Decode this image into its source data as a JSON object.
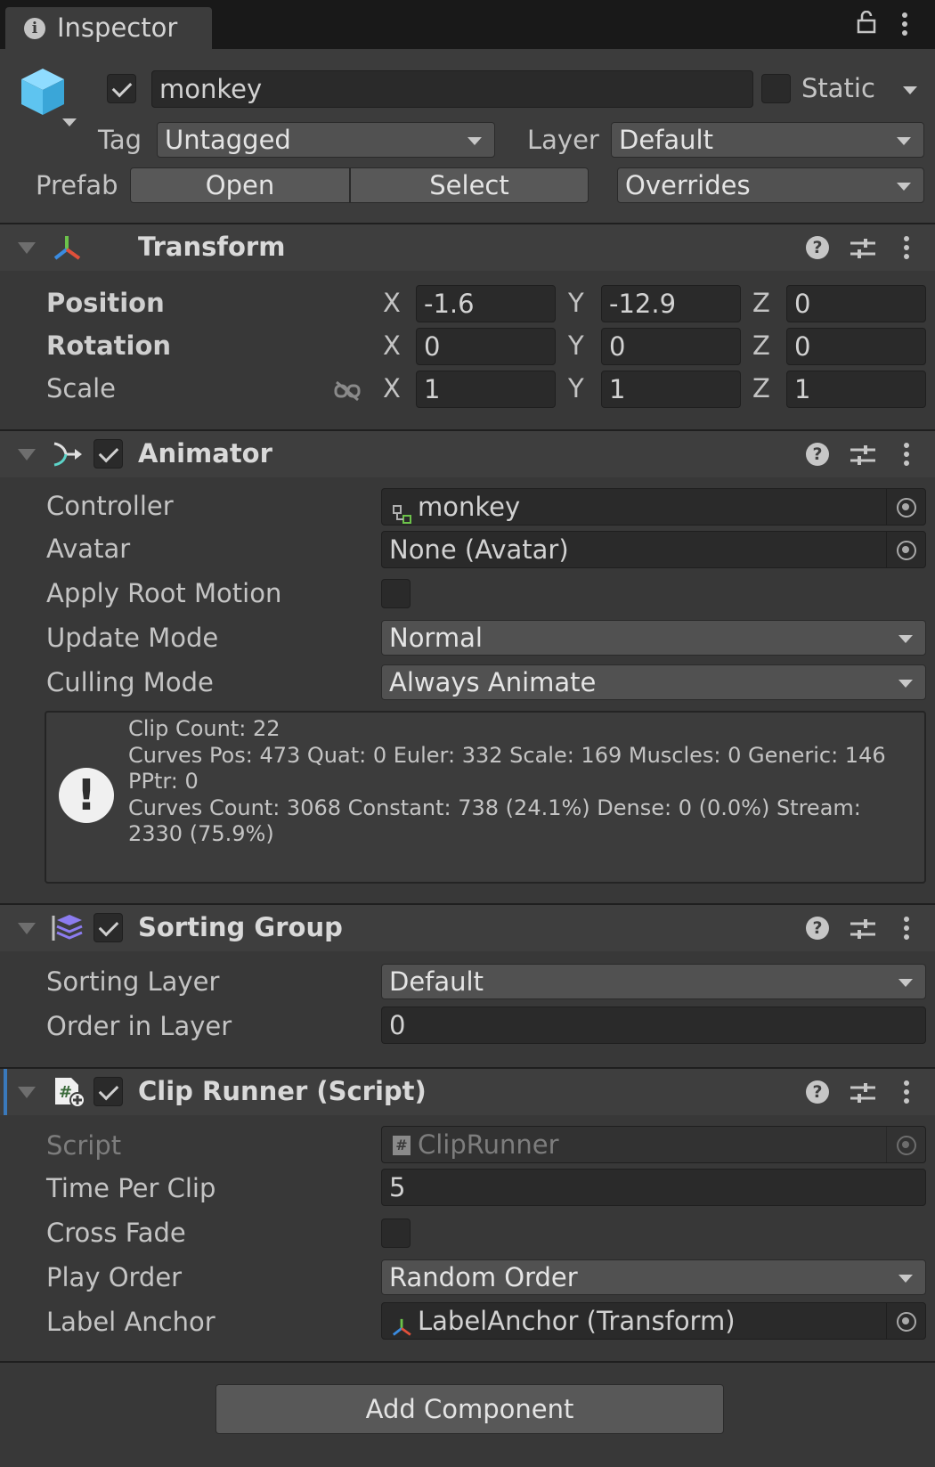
{
  "tab": {
    "title": "Inspector",
    "lock_icon": "lock-icon",
    "menu_icon": "kebab-menu-icon"
  },
  "header": {
    "active_checked": true,
    "name": "monkey",
    "static_label": "Static",
    "static_checked": false,
    "tag_label": "Tag",
    "tag_value": "Untagged",
    "layer_label": "Layer",
    "layer_value": "Default",
    "prefab_label": "Prefab",
    "open_label": "Open",
    "select_label": "Select",
    "overrides_label": "Overrides",
    "object_icon": "cube-icon"
  },
  "transform": {
    "title": "Transform",
    "icon": "transform-axes-icon",
    "position_label": "Position",
    "rotation_label": "Rotation",
    "scale_label": "Scale",
    "x": "X",
    "y": "Y",
    "z": "Z",
    "position": {
      "x": "-1.6",
      "y": "-12.9",
      "z": "0"
    },
    "rotation": {
      "x": "0",
      "y": "0",
      "z": "0"
    },
    "scale": {
      "x": "1",
      "y": "1",
      "z": "1"
    }
  },
  "animator": {
    "title": "Animator",
    "enabled": true,
    "icon": "animator-icon",
    "controller_label": "Controller",
    "controller_value": "monkey",
    "avatar_label": "Avatar",
    "avatar_value": "None (Avatar)",
    "apply_root_motion_label": "Apply Root Motion",
    "apply_root_motion": false,
    "update_mode_label": "Update Mode",
    "update_mode_value": "Normal",
    "culling_mode_label": "Culling Mode",
    "culling_mode_value": "Always Animate",
    "info_lines": [
      "Clip Count: 22",
      "Curves Pos: 473 Quat: 0 Euler: 332 Scale: 169 Muscles: 0 Generic: 146",
      "PPtr: 0",
      "Curves Count: 3068 Constant: 738 (24.1%) Dense: 0 (0.0%) Stream:",
      "2330 (75.9%)"
    ]
  },
  "sorting_group": {
    "title": "Sorting Group",
    "enabled": true,
    "icon": "layers-icon",
    "sorting_layer_label": "Sorting Layer",
    "sorting_layer_value": "Default",
    "order_label": "Order in Layer",
    "order_value": "0"
  },
  "clip_runner": {
    "title": "Clip Runner (Script)",
    "enabled": true,
    "icon": "script-icon",
    "script_label": "Script",
    "script_value": "ClipRunner",
    "time_per_clip_label": "Time Per Clip",
    "time_per_clip_value": "5",
    "cross_fade_label": "Cross Fade",
    "cross_fade": false,
    "play_order_label": "Play Order",
    "play_order_value": "Random Order",
    "label_anchor_label": "Label Anchor",
    "label_anchor_value": "LabelAnchor (Transform)"
  },
  "add_component_label": "Add Component",
  "colors": {
    "accent_blue": "#3a79bb",
    "cube_blue": "#5ec4f0",
    "panel_bg": "#383838"
  }
}
